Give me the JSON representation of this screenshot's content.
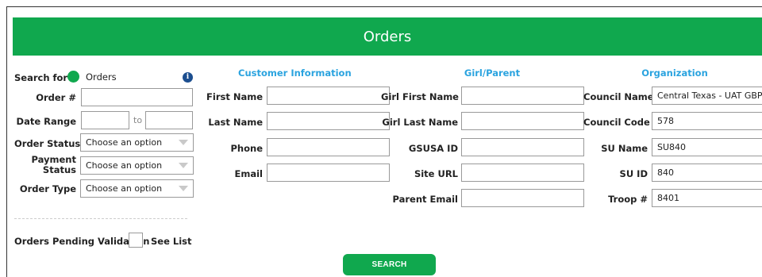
{
  "header": {
    "title": "Orders"
  },
  "search": {
    "label": "Search for",
    "mode": "Orders",
    "info_icon": "info-icon",
    "order_number_label": "Order #",
    "order_number_value": "",
    "date_range_label": "Date Range",
    "date_from": "",
    "date_to_label": "to",
    "date_to": "",
    "order_status_label": "Order Status",
    "order_status_value": "Choose an option",
    "payment_status_label_1": "Payment",
    "payment_status_label_2": "Status",
    "payment_status_value": "Choose an option",
    "order_type_label": "Order Type",
    "order_type_value": "Choose an option",
    "pending_label": "Orders Pending Validation",
    "see_list": "See List"
  },
  "customer": {
    "heading": "Customer Information",
    "first_name_label": "First Name",
    "first_name": "",
    "last_name_label": "Last Name",
    "last_name": "",
    "phone_label": "Phone",
    "phone": "",
    "email_label": "Email",
    "email": ""
  },
  "girl": {
    "heading": "Girl/Parent",
    "first_name_label": "Girl First Name",
    "first_name": "",
    "last_name_label": "Girl Last Name",
    "last_name": "",
    "gsusa_label": "GSUSA ID",
    "gsusa": "",
    "site_url_label": "Site URL",
    "site_url": "",
    "parent_email_label": "Parent Email",
    "parent_email": ""
  },
  "organization": {
    "heading": "Organization",
    "council_name_label": "Council Name",
    "council_name": "Central Texas - UAT GBP",
    "council_code_label": "Council Code",
    "council_code": "578",
    "su_name_label": "SU Name",
    "su_name": "SU840",
    "su_id_label": "SU ID",
    "su_id": "840",
    "troop_label": "Troop #",
    "troop": "8401"
  },
  "actions": {
    "search_label": "SEARCH"
  },
  "colors": {
    "brand_green": "#10a84e",
    "section_blue": "#2aa3df",
    "info_blue": "#1c4e8f"
  }
}
